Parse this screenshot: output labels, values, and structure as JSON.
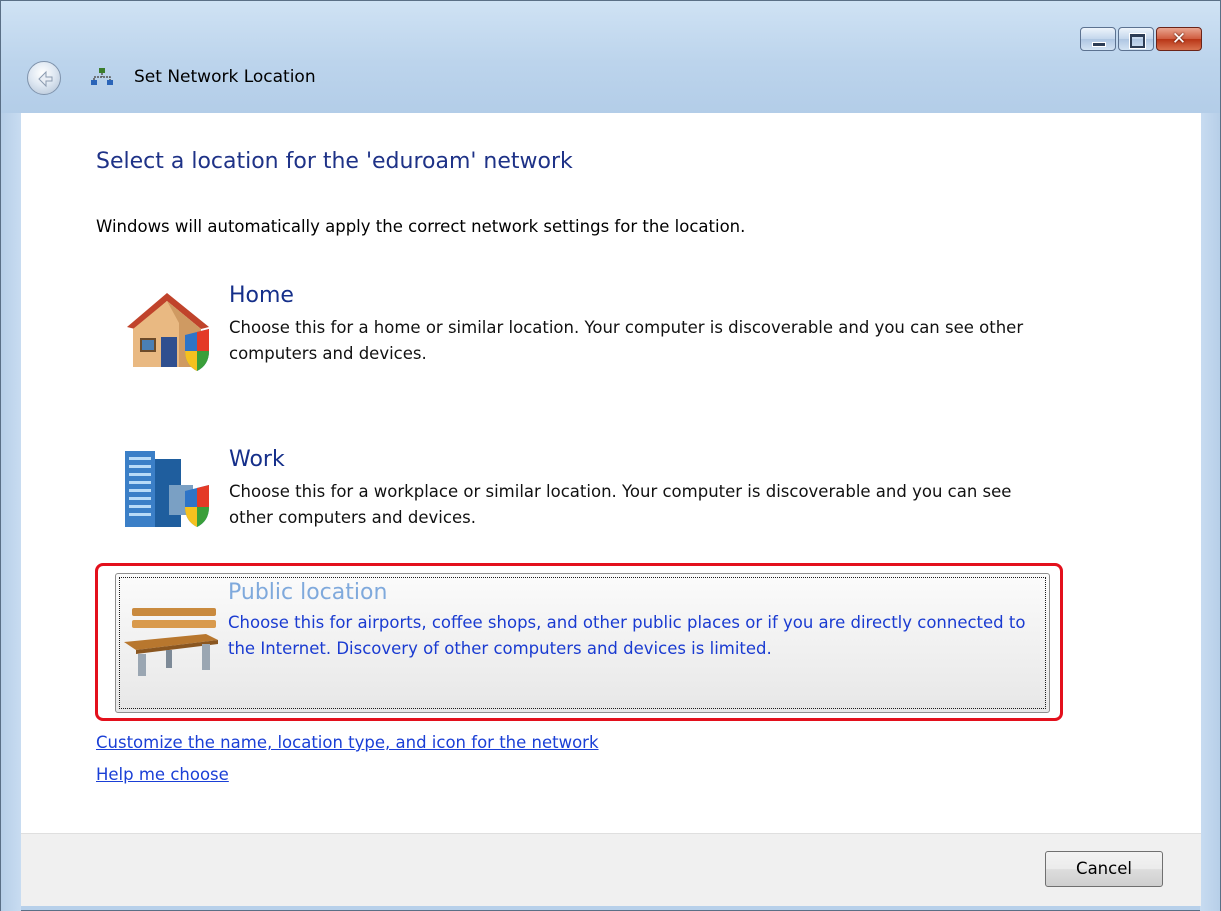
{
  "window": {
    "title": "Set Network Location",
    "buttons": {
      "minimize": "minimize",
      "maximize": "maximize",
      "close": "close"
    }
  },
  "content": {
    "heading": "Select a location for the 'eduroam' network",
    "instruction": "Windows will automatically apply the correct network settings for the location."
  },
  "options": [
    {
      "title": "Home",
      "description": "Choose this for a home or similar location. Your computer is discoverable and you can see other computers and devices.",
      "icon": "house-shield-icon"
    },
    {
      "title": "Work",
      "description": "Choose this for a workplace or similar location. Your computer is discoverable and you can see other computers and devices.",
      "icon": "office-building-shield-icon"
    },
    {
      "title": "Public location",
      "description": "Choose this for airports, coffee shops, and other public places or if you are directly connected to the Internet. Discovery of other computers and devices is limited.",
      "icon": "park-bench-icon",
      "highlighted": true
    }
  ],
  "links": {
    "customize": "Customize the name, location type, and icon for the network",
    "help": "Help me choose"
  },
  "footer": {
    "cancel_label": "Cancel"
  },
  "colors": {
    "heading": "#1e3287",
    "link": "#1a3fd6",
    "highlight_border": "#e3101c",
    "public_title": "#7fa9dc"
  }
}
